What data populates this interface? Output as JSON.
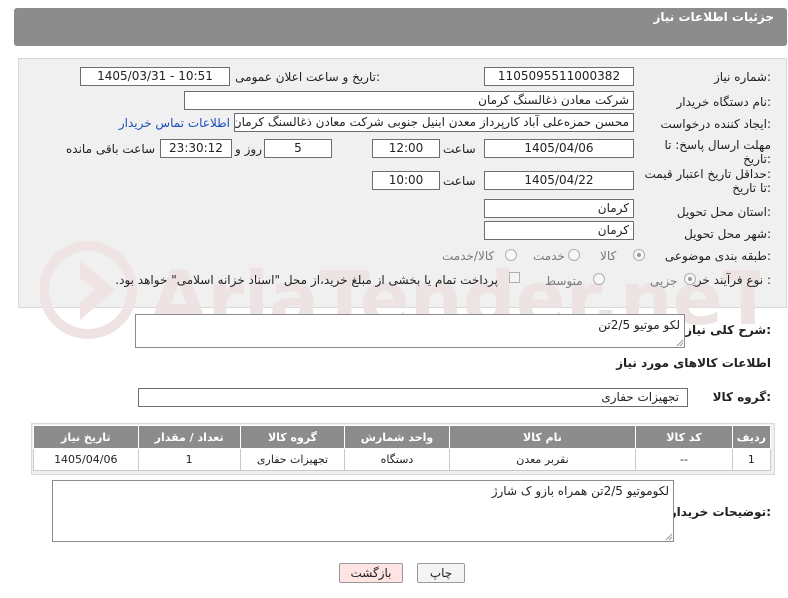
{
  "header": {
    "title": "جزئیات اطلاعات نیاز"
  },
  "form": {
    "need_number": {
      "label": "شماره نیاز:",
      "value": "1105095511000382"
    },
    "announce": {
      "label": "تاریخ و ساعت اعلان عمومی:",
      "value": "1405/03/31 - 10:51"
    },
    "buyer_org": {
      "label": "نام دستگاه خریدار:",
      "value": "شرکت معادن ذغالسنگ کرمان"
    },
    "creator": {
      "label": "ایجاد کننده درخواست:",
      "value": "محسن حمزه‌علی آباد کارپرداز معدن ابنیل جنوبی شرکت معادن ذغالسنگ کرمان",
      "contact_link": "اطلاعات تماس خریدار"
    },
    "reply_deadline": {
      "label_line1": "مهلت ارسال پاسخ: تا",
      "label_line2": "تاریخ:",
      "date": "1405/04/06",
      "time_label": "ساعت",
      "time": "12:00",
      "days": "5",
      "days_label": "روز و",
      "remaining": "23:30:12",
      "remaining_label": "ساعت باقی مانده"
    },
    "price_validity": {
      "label_line1": "حداقل تاریخ اعتبار قیمت:",
      "label_line2": "تا تاریخ:",
      "date": "1405/04/22",
      "time_label": "ساعت",
      "time": "10:00"
    },
    "province": {
      "label": "استان محل تحویل:",
      "value": "کرمان"
    },
    "city": {
      "label": "شهر محل تحویل:",
      "value": "کرمان"
    },
    "category": {
      "label": "طبقه بندی موضوعی:",
      "options": [
        "کالا",
        "خدمت",
        "کالا/خدمت"
      ],
      "selected": "کالا"
    },
    "process": {
      "label": "نوع فرآیند خرید :",
      "options": [
        "جزیی",
        "متوسط"
      ],
      "selected": "جزیی",
      "payment_note": "پرداخت تمام یا بخشی از مبلغ خرید،از محل \"اسناد خزانه اسلامی\" خواهد بود."
    }
  },
  "description": {
    "label": "شرح کلی نیاز:",
    "value": "لکو موتیو 2/5تن"
  },
  "goods_info": {
    "title": "اطلاعات کالاهای مورد نیاز"
  },
  "goods_group": {
    "label": "گروه کالا:",
    "value": "تجهیزات حفاری"
  },
  "table": {
    "headers": [
      "ردیف",
      "کد کالا",
      "نام کالا",
      "واحد شمارش",
      "گروه کالا",
      "تعداد / مقدار",
      "تاریخ نیاز"
    ],
    "rows": [
      [
        "1",
        "--",
        "نقربر معدن",
        "دستگاه",
        "تجهیزات حفاری",
        "1",
        "1405/04/06"
      ]
    ]
  },
  "buyer_notes": {
    "label": "توضیحات خریدار:",
    "value": "لکوموتیو 2/5تن همراه بازو ک شارژ"
  },
  "buttons": {
    "print": "چاپ",
    "back": "بازگشت"
  },
  "watermark": {
    "text": "AriaTender.neT"
  },
  "colors": {
    "header_bg": "#8c8c8c",
    "panel_bg": "#f0f0f0",
    "link": "#1a4fbf",
    "back_button_bg": "#ffe4e4"
  }
}
